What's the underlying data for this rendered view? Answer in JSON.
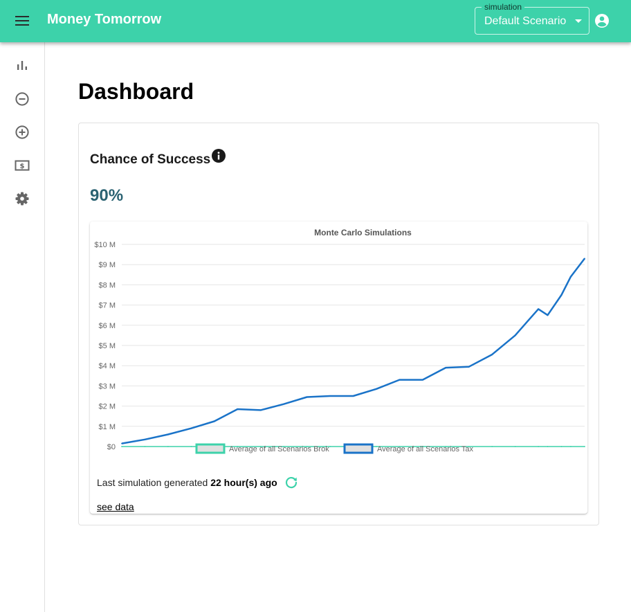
{
  "app": {
    "title": "Money Tomorrow",
    "accent_color": "#3dd2aa"
  },
  "header": {
    "menu_icon": "hamburger-menu-icon",
    "simulation_select": {
      "label": "simulation",
      "value": "Default Scenario"
    },
    "account_icon": "account-circle-icon"
  },
  "sidebar": {
    "items": [
      {
        "icon": "bar-chart-icon"
      },
      {
        "icon": "minus-circle-icon"
      },
      {
        "icon": "plus-circle-icon"
      },
      {
        "icon": "money-bill-icon"
      },
      {
        "icon": "gear-icon"
      }
    ]
  },
  "page": {
    "title": "Dashboard"
  },
  "success_card": {
    "heading": "Chance of Success",
    "info_icon": "info-icon",
    "value": "90%",
    "value_color": "#2a6272"
  },
  "chart_data": {
    "type": "line",
    "title": "Monte Carlo Simulations",
    "xlabel": "",
    "ylabel": "",
    "ylim": [
      0,
      10000000
    ],
    "yticks": [
      "$0",
      "$1 M",
      "$2 M",
      "$3 M",
      "$4 M",
      "$5 M",
      "$6 M",
      "$7 M",
      "$8 M",
      "$9 M",
      "$10 M"
    ],
    "grid": true,
    "legend_position": "bottom",
    "x": [
      0,
      0.05,
      0.1,
      0.15,
      0.2,
      0.25,
      0.3,
      0.35,
      0.4,
      0.45,
      0.5,
      0.55,
      0.6,
      0.65,
      0.7,
      0.75,
      0.8,
      0.85,
      0.9,
      0.92,
      0.95,
      0.97,
      1.0
    ],
    "series": [
      {
        "name": "Average of all Scenarios Brok",
        "color": "#3dd2aa",
        "values": [
          0,
          0,
          0,
          0,
          0,
          0,
          0,
          0,
          0,
          0,
          0,
          0,
          0,
          0,
          0,
          0,
          0,
          0,
          0,
          0,
          0,
          0,
          0
        ]
      },
      {
        "name": "Average of all Scenarios Tax",
        "color": "#1a73c8",
        "values": [
          150000,
          350000,
          600000,
          900000,
          1250000,
          1850000,
          1800000,
          2100000,
          2450000,
          2500000,
          2500000,
          2850000,
          3300000,
          3300000,
          3900000,
          3950000,
          4550000,
          5500000,
          6800000,
          6500000,
          7500000,
          8400000,
          9300000
        ]
      }
    ]
  },
  "status": {
    "last_sim_prefix": "Last simulation generated",
    "last_sim_age": "22 hour(s) ago",
    "refresh_icon": "refresh-icon",
    "see_data_label": "see data"
  }
}
